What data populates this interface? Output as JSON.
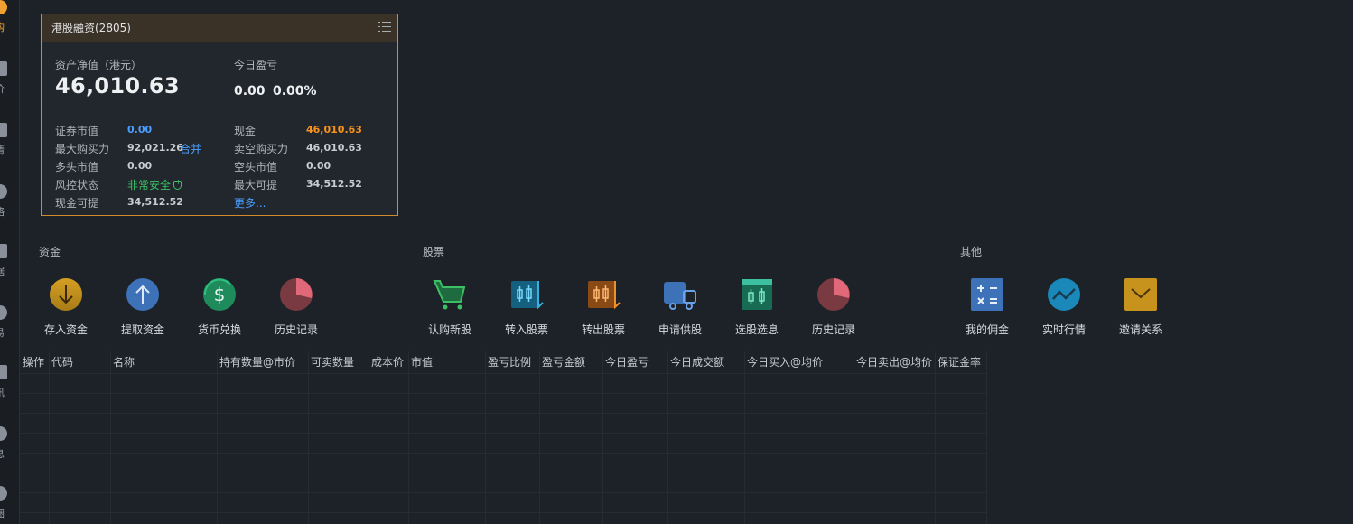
{
  "sidebar": {
    "items": [
      {
        "label": "购",
        "icon": "user-icon",
        "active": true
      },
      {
        "label": "价",
        "icon": "price-icon"
      },
      {
        "label": "情",
        "icon": "chart-icon"
      },
      {
        "label": "略",
        "icon": "strategy-icon"
      },
      {
        "label": "据",
        "icon": "data-icon"
      },
      {
        "label": "易",
        "icon": "trade-icon"
      },
      {
        "label": "讯",
        "icon": "news-icon"
      },
      {
        "label": "息",
        "icon": "message-icon"
      },
      {
        "label": "圈",
        "icon": "circle-icon"
      }
    ]
  },
  "account": {
    "title": "港股融资(2805)",
    "net_asset_label": "资产净值（港元）",
    "net_asset_value": "46,010.63",
    "today_pl_label": "今日盈亏",
    "today_pl_value": "0.00",
    "today_pl_pct": "0.00%",
    "rows": [
      {
        "left_label": "证券市值",
        "left_value": "0.00",
        "right_label": "现金",
        "right_value": "46,010.63"
      },
      {
        "left_label": "最大购买力",
        "left_value": "92,021.26",
        "left_link": "合并",
        "right_label": "卖空购买力",
        "right_value": "46,010.63"
      },
      {
        "left_label": "多头市值",
        "left_value": "0.00",
        "right_label": "空头市值",
        "right_value": "0.00"
      },
      {
        "left_label": "风控状态",
        "left_value": "非常安全",
        "right_label": "最大可提",
        "right_value": "34,512.52"
      },
      {
        "left_label": "现金可提",
        "left_value": "34,512.52",
        "right_label": "",
        "right_value": "",
        "right_link": "更多..."
      }
    ]
  },
  "sections": {
    "funds": {
      "title": "资金",
      "actions": [
        {
          "label": "存入资金",
          "icon": "deposit-icon",
          "color": "#c8931c"
        },
        {
          "label": "提取资金",
          "icon": "withdraw-icon",
          "color": "#3d72b8"
        },
        {
          "label": "货币兑换",
          "icon": "currency-exchange-icon",
          "color": "#1f8a5c"
        },
        {
          "label": "历史记录",
          "icon": "history-pie-icon",
          "color": "#b84a58"
        }
      ]
    },
    "stocks": {
      "title": "股票",
      "actions": [
        {
          "label": "认购新股",
          "icon": "cart-icon",
          "color": "#3cc064"
        },
        {
          "label": "转入股票",
          "icon": "transfer-in-icon",
          "color": "#1a88b8"
        },
        {
          "label": "转出股票",
          "icon": "transfer-out-icon",
          "color": "#d87a22"
        },
        {
          "label": "申请供股",
          "icon": "truck-icon",
          "color": "#3d72b8"
        },
        {
          "label": "选股选息",
          "icon": "select-stock-icon",
          "color": "#28a07a"
        },
        {
          "label": "历史记录",
          "icon": "history-pie-icon",
          "color": "#b84a58"
        }
      ]
    },
    "others": {
      "title": "其他",
      "actions": [
        {
          "label": "我的佣金",
          "icon": "calculator-icon",
          "color": "#3d72b8"
        },
        {
          "label": "实时行情",
          "icon": "realtime-quote-icon",
          "color": "#1a88b8"
        },
        {
          "label": "邀请关系",
          "icon": "envelope-icon",
          "color": "#c8931c"
        }
      ]
    }
  },
  "table": {
    "columns": [
      "操作",
      "代码",
      "名称",
      "持有数量@市价",
      "可卖数量",
      "成本价",
      "市值",
      "盈亏比例",
      "盈亏金额",
      "今日盈亏",
      "今日成交额",
      "今日买入@均价",
      "今日卖出@均价",
      "保证金率"
    ]
  }
}
